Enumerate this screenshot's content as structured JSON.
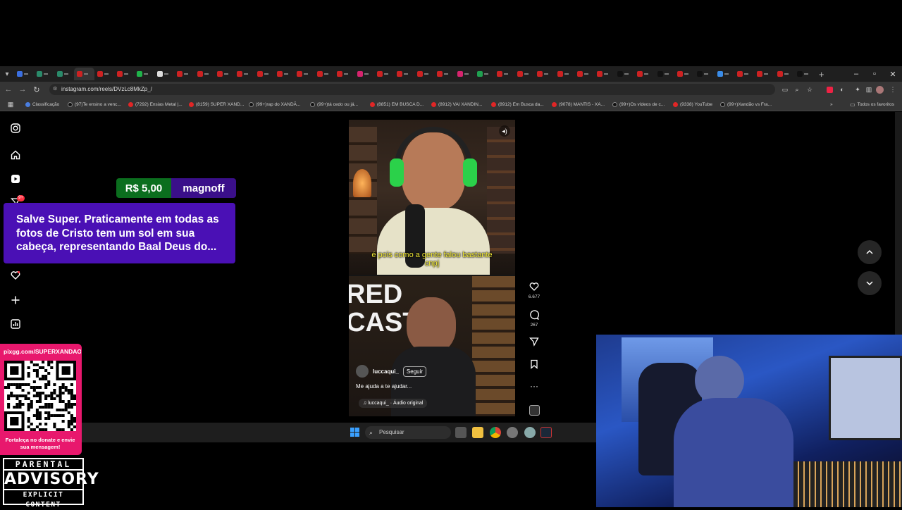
{
  "browser": {
    "url": "instagram.com/reels/DVzLc8MkZp_/",
    "all_bookmarks_label": "Todos os favoritos",
    "bookmarks": [
      {
        "label": "Classificação",
        "icon": "globe"
      },
      {
        "label": "(97)Te ensino a venc...",
        "icon": "tiktok"
      },
      {
        "label": "(7292) Ensias Metal |...",
        "icon": "youtube"
      },
      {
        "label": "(8159) SUPER XAND...",
        "icon": "youtube"
      },
      {
        "label": "(99+)rap do XANDÃ...",
        "icon": "tiktok"
      },
      {
        "label": "(99+)tá cedo ou já...",
        "icon": "tiktok"
      },
      {
        "label": "(8851) EM BUSCA D...",
        "icon": "youtube"
      },
      {
        "label": "(8912) VAI XANDIN...",
        "icon": "youtube"
      },
      {
        "label": "(8912) Em Busca da...",
        "icon": "youtube"
      },
      {
        "label": "(9078) MANTIS - XA...",
        "icon": "youtube"
      },
      {
        "label": "(99+)Os vídeos de c...",
        "icon": "tiktok"
      },
      {
        "label": "(9338) YouTube",
        "icon": "youtube"
      },
      {
        "label": "(99+)Xandão vs Fra...",
        "icon": "tiktok"
      }
    ]
  },
  "reel": {
    "subtitle": "é pois como a gente falou bastante cnpj",
    "overlay_text": "RED CAST",
    "username": "luccaqui_",
    "follow_label": "Seguir",
    "caption": "Me ajuda a te ajudar...",
    "audio": "luccaqui_ · Áudio original",
    "likes": "6.677",
    "comments": "267"
  },
  "donation": {
    "amount": "R$ 5,00",
    "name": "magnoff",
    "message": "Salve Super. Praticamente em todas as fotos de Cristo tem um sol em sua cabeça, representando Baal Deus do..."
  },
  "pix": {
    "url": "pixgg.com/SUPERXANDAO",
    "cta": "Fortaleça no donate e envie sua mensagem!"
  },
  "advisory": {
    "line1": "PARENTAL",
    "line2": "ADVISORY",
    "line3": "EXPLICIT CONTENT"
  },
  "taskbar": {
    "search_placeholder": "Pesquisar"
  },
  "notification_badge": "9+"
}
